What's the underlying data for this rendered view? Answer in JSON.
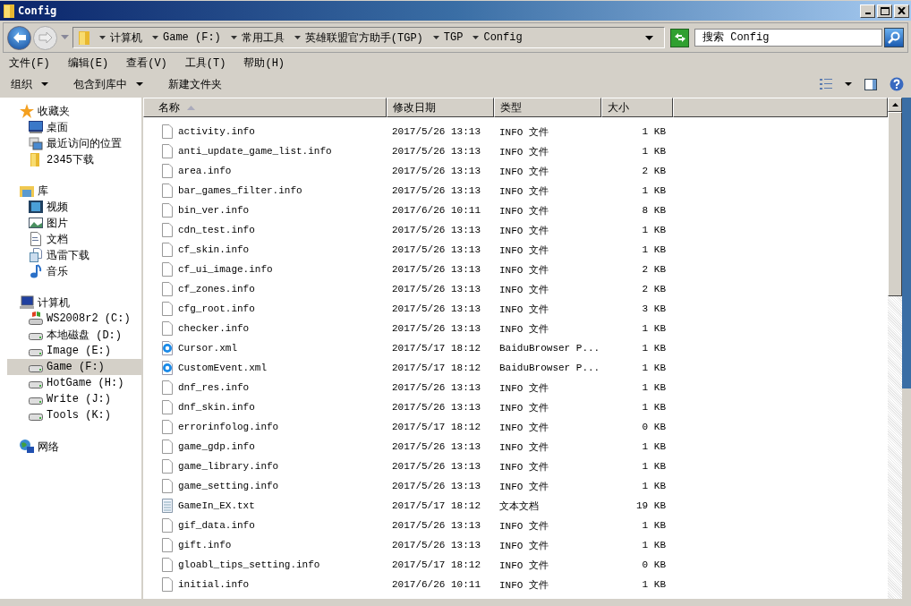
{
  "window": {
    "title": "Config"
  },
  "address": {
    "segments": [
      "计算机",
      "Game (F:)",
      "常用工具",
      "英雄联盟官方助手(TGP)",
      "TGP",
      "Config"
    ]
  },
  "search": {
    "placeholder": "搜索 Config"
  },
  "menu": [
    "文件(F)",
    "编辑(E)",
    "查看(V)",
    "工具(T)",
    "帮助(H)"
  ],
  "commands": [
    {
      "label": "组织",
      "dropdown": true
    },
    {
      "label": "包含到库中",
      "dropdown": true
    },
    {
      "label": "新建文件夹",
      "dropdown": false
    }
  ],
  "sidebar": {
    "groups": [
      {
        "label": "收藏夹",
        "kind": "star",
        "children": [
          {
            "label": "桌面",
            "kind": "desktop",
            "selected": false
          },
          {
            "label": "最近访问的位置",
            "kind": "recent",
            "selected": false
          },
          {
            "label": "2345下载",
            "kind": "folder",
            "selected": false
          }
        ]
      },
      {
        "label": "库",
        "kind": "library",
        "children": [
          {
            "label": "视频",
            "kind": "video",
            "selected": false
          },
          {
            "label": "图片",
            "kind": "picture",
            "selected": false
          },
          {
            "label": "文档",
            "kind": "document",
            "selected": false
          },
          {
            "label": "迅雷下载",
            "kind": "copy",
            "selected": false
          },
          {
            "label": "音乐",
            "kind": "music",
            "selected": false
          }
        ]
      },
      {
        "label": "计算机",
        "kind": "computer",
        "children": [
          {
            "label": "WS2008r2 (C:)",
            "kind": "system",
            "selected": false
          },
          {
            "label": "本地磁盘 (D:)",
            "kind": "drive",
            "selected": false
          },
          {
            "label": "Image (E:)",
            "kind": "drive",
            "selected": false
          },
          {
            "label": "Game (F:)",
            "kind": "drive",
            "selected": true
          },
          {
            "label": "HotGame (H:)",
            "kind": "drive",
            "selected": false
          },
          {
            "label": "Write (J:)",
            "kind": "drive",
            "selected": false
          },
          {
            "label": "Tools (K:)",
            "kind": "drive",
            "selected": false
          }
        ]
      },
      {
        "label": "网络",
        "kind": "network"
      }
    ]
  },
  "table": {
    "columns": [
      {
        "label": "名称",
        "sorted": true
      },
      {
        "label": "修改日期",
        "sorted": false
      },
      {
        "label": "类型",
        "sorted": false
      },
      {
        "label": "大小",
        "sorted": false
      }
    ],
    "rows": [
      {
        "name": "activity.info",
        "kind": "info",
        "modified": "2017/5/26 13:13",
        "type": "INFO 文件",
        "size": "1 KB"
      },
      {
        "name": "anti_update_game_list.info",
        "kind": "info",
        "modified": "2017/5/26 13:13",
        "type": "INFO 文件",
        "size": "1 KB"
      },
      {
        "name": "area.info",
        "kind": "info",
        "modified": "2017/5/26 13:13",
        "type": "INFO 文件",
        "size": "2 KB"
      },
      {
        "name": "bar_games_filter.info",
        "kind": "info",
        "modified": "2017/5/26 13:13",
        "type": "INFO 文件",
        "size": "1 KB"
      },
      {
        "name": "bin_ver.info",
        "kind": "info",
        "modified": "2017/6/26 10:11",
        "type": "INFO 文件",
        "size": "8 KB"
      },
      {
        "name": "cdn_test.info",
        "kind": "info",
        "modified": "2017/5/26 13:13",
        "type": "INFO 文件",
        "size": "1 KB"
      },
      {
        "name": "cf_skin.info",
        "kind": "info",
        "modified": "2017/5/26 13:13",
        "type": "INFO 文件",
        "size": "1 KB"
      },
      {
        "name": "cf_ui_image.info",
        "kind": "info",
        "modified": "2017/5/26 13:13",
        "type": "INFO 文件",
        "size": "2 KB"
      },
      {
        "name": "cf_zones.info",
        "kind": "info",
        "modified": "2017/5/26 13:13",
        "type": "INFO 文件",
        "size": "2 KB"
      },
      {
        "name": "cfg_root.info",
        "kind": "info",
        "modified": "2017/5/26 13:13",
        "type": "INFO 文件",
        "size": "3 KB"
      },
      {
        "name": "checker.info",
        "kind": "info",
        "modified": "2017/5/26 13:13",
        "type": "INFO 文件",
        "size": "1 KB"
      },
      {
        "name": "Cursor.xml",
        "kind": "xml",
        "modified": "2017/5/17 18:12",
        "type": "BaiduBrowser P...",
        "size": "1 KB"
      },
      {
        "name": "CustomEvent.xml",
        "kind": "xml",
        "modified": "2017/5/17 18:12",
        "type": "BaiduBrowser P...",
        "size": "1 KB"
      },
      {
        "name": "dnf_res.info",
        "kind": "info",
        "modified": "2017/5/26 13:13",
        "type": "INFO 文件",
        "size": "1 KB"
      },
      {
        "name": "dnf_skin.info",
        "kind": "info",
        "modified": "2017/5/26 13:13",
        "type": "INFO 文件",
        "size": "1 KB"
      },
      {
        "name": "errorinfolog.info",
        "kind": "info",
        "modified": "2017/5/17 18:12",
        "type": "INFO 文件",
        "size": "0 KB"
      },
      {
        "name": "game_gdp.info",
        "kind": "info",
        "modified": "2017/5/26 13:13",
        "type": "INFO 文件",
        "size": "1 KB"
      },
      {
        "name": "game_library.info",
        "kind": "info",
        "modified": "2017/5/26 13:13",
        "type": "INFO 文件",
        "size": "1 KB"
      },
      {
        "name": "game_setting.info",
        "kind": "info",
        "modified": "2017/5/26 13:13",
        "type": "INFO 文件",
        "size": "1 KB"
      },
      {
        "name": "GameIn_EX.txt",
        "kind": "txt",
        "modified": "2017/5/17 18:12",
        "type": "文本文档",
        "size": "19 KB"
      },
      {
        "name": "gif_data.info",
        "kind": "info",
        "modified": "2017/5/26 13:13",
        "type": "INFO 文件",
        "size": "1 KB"
      },
      {
        "name": "gift.info",
        "kind": "info",
        "modified": "2017/5/26 13:13",
        "type": "INFO 文件",
        "size": "1 KB"
      },
      {
        "name": "gloabl_tips_setting.info",
        "kind": "info",
        "modified": "2017/5/17 18:12",
        "type": "INFO 文件",
        "size": "0 KB"
      },
      {
        "name": "initial.info",
        "kind": "info",
        "modified": "2017/6/26 10:11",
        "type": "INFO 文件",
        "size": "1 KB"
      }
    ]
  }
}
